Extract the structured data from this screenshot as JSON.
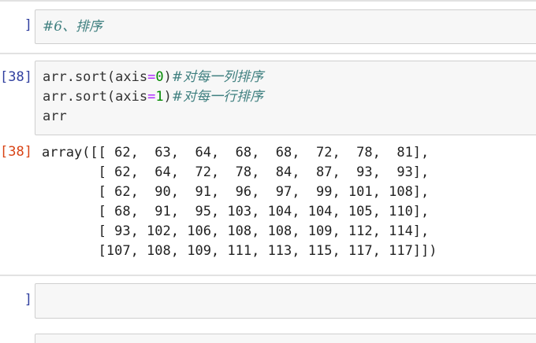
{
  "cells": [
    {
      "prompt": "   ]:",
      "comment": "#6、排序"
    },
    {
      "prompt": "[38]:",
      "lines": [
        {
          "pre": "arr.sort",
          "open": "(",
          "kw": "axis",
          "eq": "=",
          "val": "0",
          "close": ")",
          "comment": "#对每一列排序"
        },
        {
          "pre": "arr.sort",
          "open": "(",
          "kw": "axis",
          "eq": "=",
          "val": "1",
          "close": ")",
          "comment": "#对每一行排序"
        },
        {
          "pre": "arr"
        }
      ]
    },
    {
      "prompt": "[38]:",
      "output_lines": [
        "array([[ 62,  63,  64,  68,  68,  72,  78,  81],",
        "       [ 62,  64,  72,  78,  84,  87,  93,  93],",
        "       [ 62,  90,  91,  96,  97,  99, 101, 108],",
        "       [ 68,  91,  95, 103, 104, 104, 105, 110],",
        "       [ 93, 102, 106, 108, 108, 109, 112, 114],",
        "       [107, 108, 109, 111, 113, 115, 117, 117]])"
      ]
    },
    {
      "prompt": "   ]:",
      "code": ""
    }
  ]
}
